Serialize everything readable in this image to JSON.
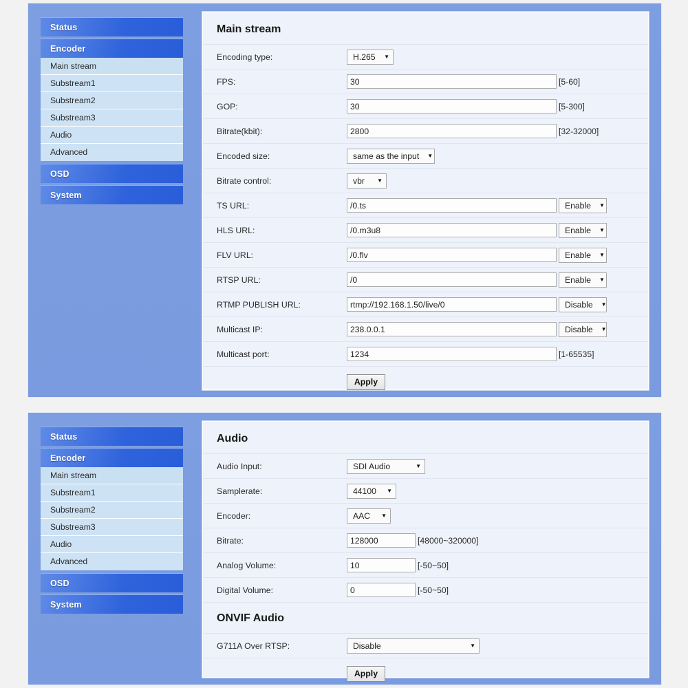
{
  "theme": {
    "page_bg": "#f2f2f2",
    "panel_blue": "#7a9bdf",
    "nav_main_blue": "#2f63dc",
    "nav_sub_blue": "#cde2f4",
    "content_bg": "#edf2fb",
    "text_dark": "#2b2b2b"
  },
  "sidebar": {
    "groups": [
      {
        "label": "Status",
        "expanded": false,
        "items": []
      },
      {
        "label": "Encoder",
        "expanded": true,
        "items": [
          {
            "label": "Main stream",
            "active": true
          },
          {
            "label": "Substream1",
            "active": false
          },
          {
            "label": "Substream2",
            "active": false
          },
          {
            "label": "Substream3",
            "active": false
          },
          {
            "label": "Audio",
            "active": false
          },
          {
            "label": "Advanced",
            "active": false
          }
        ]
      },
      {
        "label": "OSD",
        "expanded": false,
        "items": []
      },
      {
        "label": "System",
        "expanded": false,
        "items": []
      }
    ]
  },
  "panels": [
    {
      "title": "Main stream",
      "apply_label": "Apply",
      "rows": [
        {
          "label": "Encoding type:",
          "kind": "select",
          "value": "H.265",
          "size": "enc",
          "hint": ""
        },
        {
          "label": "FPS:",
          "kind": "text",
          "value": "30",
          "size": "wide",
          "hint": "[5-60]"
        },
        {
          "label": "GOP:",
          "kind": "text",
          "value": "30",
          "size": "wide",
          "hint": "[5-300]"
        },
        {
          "label": "Bitrate(kbit):",
          "kind": "text",
          "value": "2800",
          "size": "wide",
          "hint": "[32-32000]"
        },
        {
          "label": "Encoded size:",
          "kind": "select",
          "value": "same as the input",
          "size": "size",
          "hint": ""
        },
        {
          "label": "Bitrate control:",
          "kind": "select",
          "value": "vbr",
          "size": "ctrl",
          "hint": ""
        },
        {
          "label": "TS URL:",
          "kind": "text+select",
          "value": "/0.ts",
          "size": "url",
          "state": "Enable"
        },
        {
          "label": "HLS URL:",
          "kind": "text+select",
          "value": "/0.m3u8",
          "size": "url",
          "state": "Enable"
        },
        {
          "label": "FLV URL:",
          "kind": "text+select",
          "value": "/0.flv",
          "size": "url",
          "state": "Enable"
        },
        {
          "label": "RTSP URL:",
          "kind": "text+select",
          "value": "/0",
          "size": "url",
          "state": "Enable"
        },
        {
          "label": "RTMP PUBLISH URL:",
          "kind": "text+select",
          "value": "rtmp://192.168.1.50/live/0",
          "size": "url",
          "state": "Disable"
        },
        {
          "label": "Multicast IP:",
          "kind": "text+select",
          "value": "238.0.0.1",
          "size": "url",
          "state": "Disable"
        },
        {
          "label": "Multicast port:",
          "kind": "text",
          "value": "1234",
          "size": "wide",
          "hint": "[1-65535]"
        }
      ]
    },
    {
      "title": "Audio",
      "subtitle": "ONVIF Audio",
      "apply_label": "Apply",
      "rows": [
        {
          "label": "Audio Input:",
          "kind": "select",
          "value": "SDI Audio",
          "size": "ainput",
          "hint": ""
        },
        {
          "label": "Samplerate:",
          "kind": "select",
          "value": "44100",
          "size": "srate",
          "hint": ""
        },
        {
          "label": "Encoder:",
          "kind": "select",
          "value": "AAC",
          "size": "aenc",
          "hint": ""
        },
        {
          "label": "Bitrate:",
          "kind": "text",
          "value": "128000",
          "size": "small",
          "hint": "[48000~320000]"
        },
        {
          "label": "Analog Volume:",
          "kind": "text",
          "value": "10",
          "size": "small",
          "hint": "[-50~50]"
        },
        {
          "label": "Digital Volume:",
          "kind": "text",
          "value": "0",
          "size": "small",
          "hint": "[-50~50]"
        }
      ],
      "sub_rows": [
        {
          "label": "G711A Over RTSP:",
          "kind": "select",
          "value": "Disable",
          "size": "g711",
          "hint": ""
        }
      ]
    }
  ],
  "icons": {
    "caret": "▼"
  }
}
